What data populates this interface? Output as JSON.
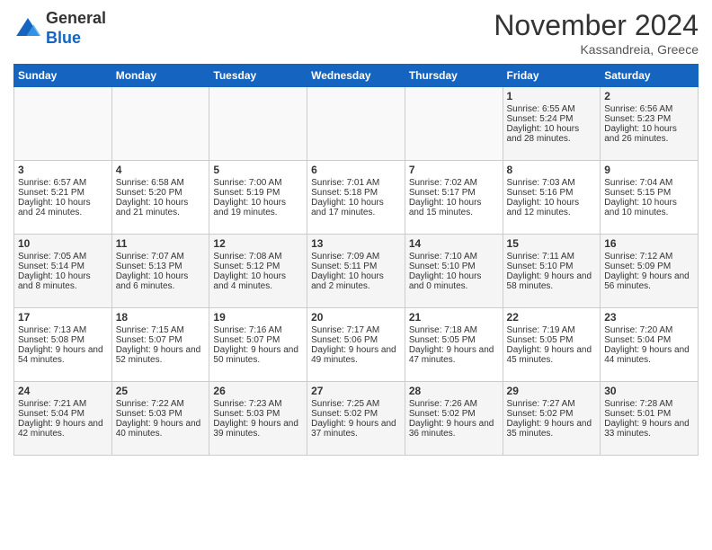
{
  "header": {
    "logo_line1": "General",
    "logo_line2": "Blue",
    "month": "November 2024",
    "location": "Kassandreia, Greece"
  },
  "weekdays": [
    "Sunday",
    "Monday",
    "Tuesday",
    "Wednesday",
    "Thursday",
    "Friday",
    "Saturday"
  ],
  "weeks": [
    [
      {
        "day": "",
        "info": ""
      },
      {
        "day": "",
        "info": ""
      },
      {
        "day": "",
        "info": ""
      },
      {
        "day": "",
        "info": ""
      },
      {
        "day": "",
        "info": ""
      },
      {
        "day": "1",
        "info": "Sunrise: 6:55 AM\nSunset: 5:24 PM\nDaylight: 10 hours and 28 minutes."
      },
      {
        "day": "2",
        "info": "Sunrise: 6:56 AM\nSunset: 5:23 PM\nDaylight: 10 hours and 26 minutes."
      }
    ],
    [
      {
        "day": "3",
        "info": "Sunrise: 6:57 AM\nSunset: 5:21 PM\nDaylight: 10 hours and 24 minutes."
      },
      {
        "day": "4",
        "info": "Sunrise: 6:58 AM\nSunset: 5:20 PM\nDaylight: 10 hours and 21 minutes."
      },
      {
        "day": "5",
        "info": "Sunrise: 7:00 AM\nSunset: 5:19 PM\nDaylight: 10 hours and 19 minutes."
      },
      {
        "day": "6",
        "info": "Sunrise: 7:01 AM\nSunset: 5:18 PM\nDaylight: 10 hours and 17 minutes."
      },
      {
        "day": "7",
        "info": "Sunrise: 7:02 AM\nSunset: 5:17 PM\nDaylight: 10 hours and 15 minutes."
      },
      {
        "day": "8",
        "info": "Sunrise: 7:03 AM\nSunset: 5:16 PM\nDaylight: 10 hours and 12 minutes."
      },
      {
        "day": "9",
        "info": "Sunrise: 7:04 AM\nSunset: 5:15 PM\nDaylight: 10 hours and 10 minutes."
      }
    ],
    [
      {
        "day": "10",
        "info": "Sunrise: 7:05 AM\nSunset: 5:14 PM\nDaylight: 10 hours and 8 minutes."
      },
      {
        "day": "11",
        "info": "Sunrise: 7:07 AM\nSunset: 5:13 PM\nDaylight: 10 hours and 6 minutes."
      },
      {
        "day": "12",
        "info": "Sunrise: 7:08 AM\nSunset: 5:12 PM\nDaylight: 10 hours and 4 minutes."
      },
      {
        "day": "13",
        "info": "Sunrise: 7:09 AM\nSunset: 5:11 PM\nDaylight: 10 hours and 2 minutes."
      },
      {
        "day": "14",
        "info": "Sunrise: 7:10 AM\nSunset: 5:10 PM\nDaylight: 10 hours and 0 minutes."
      },
      {
        "day": "15",
        "info": "Sunrise: 7:11 AM\nSunset: 5:10 PM\nDaylight: 9 hours and 58 minutes."
      },
      {
        "day": "16",
        "info": "Sunrise: 7:12 AM\nSunset: 5:09 PM\nDaylight: 9 hours and 56 minutes."
      }
    ],
    [
      {
        "day": "17",
        "info": "Sunrise: 7:13 AM\nSunset: 5:08 PM\nDaylight: 9 hours and 54 minutes."
      },
      {
        "day": "18",
        "info": "Sunrise: 7:15 AM\nSunset: 5:07 PM\nDaylight: 9 hours and 52 minutes."
      },
      {
        "day": "19",
        "info": "Sunrise: 7:16 AM\nSunset: 5:07 PM\nDaylight: 9 hours and 50 minutes."
      },
      {
        "day": "20",
        "info": "Sunrise: 7:17 AM\nSunset: 5:06 PM\nDaylight: 9 hours and 49 minutes."
      },
      {
        "day": "21",
        "info": "Sunrise: 7:18 AM\nSunset: 5:05 PM\nDaylight: 9 hours and 47 minutes."
      },
      {
        "day": "22",
        "info": "Sunrise: 7:19 AM\nSunset: 5:05 PM\nDaylight: 9 hours and 45 minutes."
      },
      {
        "day": "23",
        "info": "Sunrise: 7:20 AM\nSunset: 5:04 PM\nDaylight: 9 hours and 44 minutes."
      }
    ],
    [
      {
        "day": "24",
        "info": "Sunrise: 7:21 AM\nSunset: 5:04 PM\nDaylight: 9 hours and 42 minutes."
      },
      {
        "day": "25",
        "info": "Sunrise: 7:22 AM\nSunset: 5:03 PM\nDaylight: 9 hours and 40 minutes."
      },
      {
        "day": "26",
        "info": "Sunrise: 7:23 AM\nSunset: 5:03 PM\nDaylight: 9 hours and 39 minutes."
      },
      {
        "day": "27",
        "info": "Sunrise: 7:25 AM\nSunset: 5:02 PM\nDaylight: 9 hours and 37 minutes."
      },
      {
        "day": "28",
        "info": "Sunrise: 7:26 AM\nSunset: 5:02 PM\nDaylight: 9 hours and 36 minutes."
      },
      {
        "day": "29",
        "info": "Sunrise: 7:27 AM\nSunset: 5:02 PM\nDaylight: 9 hours and 35 minutes."
      },
      {
        "day": "30",
        "info": "Sunrise: 7:28 AM\nSunset: 5:01 PM\nDaylight: 9 hours and 33 minutes."
      }
    ]
  ]
}
